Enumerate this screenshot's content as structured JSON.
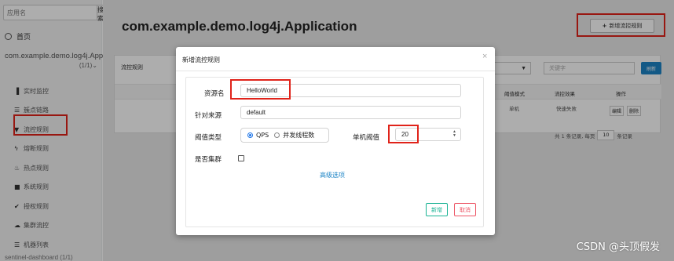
{
  "sidebar": {
    "search_placeholder": "应用名",
    "search_button": "搜索",
    "home": "首页",
    "app_name": "com.example.demo.log4j.Application",
    "app_count": "(1/1)",
    "nav": [
      {
        "label": "实时监控",
        "icon": "bar-chart-icon"
      },
      {
        "label": "簇点链路",
        "icon": "list-icon"
      },
      {
        "label": "流控规则",
        "icon": "filter-icon"
      },
      {
        "label": "熔断规则",
        "icon": "bolt-icon"
      },
      {
        "label": "热点规则",
        "icon": "fire-icon"
      },
      {
        "label": "系统规则",
        "icon": "lock-icon"
      },
      {
        "label": "授权规则",
        "icon": "check-icon"
      },
      {
        "label": "集群流控",
        "icon": "cloud-icon"
      },
      {
        "label": "机器列表",
        "icon": "list-icon"
      }
    ],
    "footer": "sentinel-dashboard (1/1)"
  },
  "main": {
    "title": "com.example.demo.log4j.Application",
    "add_button": "新增流控规则",
    "panel_title": "流控规则",
    "keyword_placeholder": "关键字",
    "refresh_button": "刷新",
    "columns": [
      "阈值模式",
      "流控效果",
      "操作"
    ],
    "row": {
      "threshold_mode": "单机",
      "effect": "快速失败",
      "edit": "编辑",
      "delete": "删除"
    },
    "pager_prefix": "共 1 条记录, 每页",
    "page_size": "10",
    "pager_suffix": "条记录"
  },
  "modal": {
    "title": "新增流控规则",
    "close": "×",
    "resource_label": "资源名",
    "resource_value": "HelloWorld",
    "source_label": "针对来源",
    "source_value": "default",
    "threshold_type_label": "阈值类型",
    "threshold_options": [
      {
        "label": "QPS",
        "selected": true
      },
      {
        "label": "并发线程数",
        "selected": false
      }
    ],
    "single_threshold_label": "单机阈值",
    "single_threshold_value": "20",
    "cluster_label": "是否集群",
    "cluster_checked": false,
    "advanced_link": "高级选项",
    "save_button": "新增",
    "cancel_button": "取消"
  },
  "watermark": "CSDN @头顶假发"
}
